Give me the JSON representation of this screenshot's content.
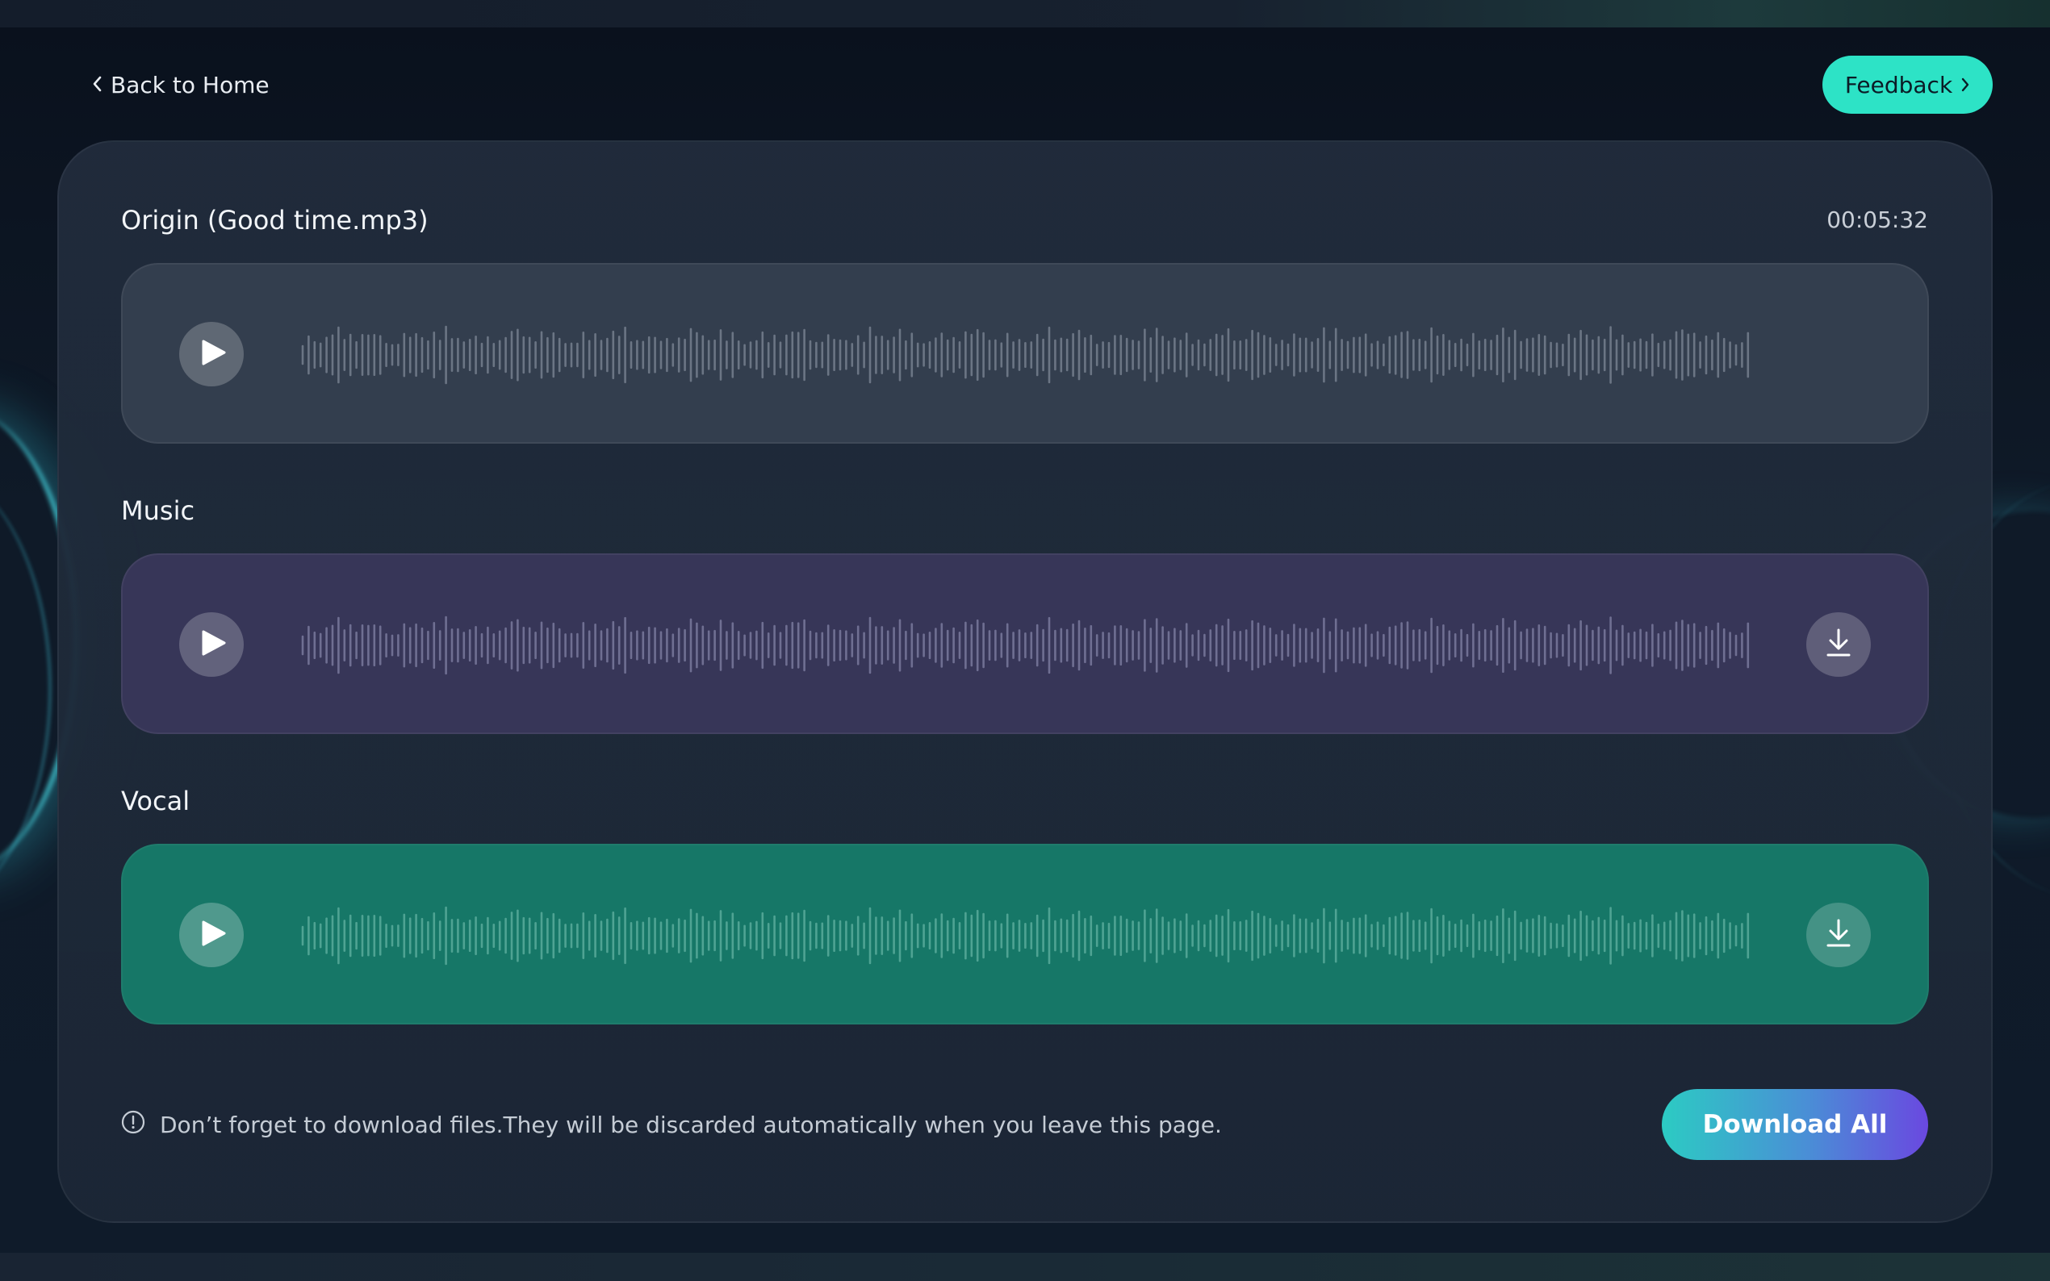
{
  "nav": {
    "back_label": "Back to Home",
    "back_icon": "chevron-left-icon",
    "feedback_label": "Feedback",
    "feedback_icon": "chevron-right-icon"
  },
  "tracks": [
    {
      "id": "origin",
      "title": "Origin (Good time.mp3)",
      "duration": "00:05:32",
      "downloadable": false,
      "color": "#333e4e",
      "wave_color": "#6b7584"
    },
    {
      "id": "music",
      "title": "Music",
      "downloadable": true,
      "color": "#373658",
      "wave_color": "#6f6f92"
    },
    {
      "id": "vocal",
      "title": "Vocal",
      "downloadable": true,
      "color": "#167767",
      "wave_color": "#4fa393"
    }
  ],
  "footer": {
    "notice": "Don’t forget to download files.They will be discarded automatically when you leave this page.",
    "notice_icon": "info-circle-icon",
    "download_all_label": "Download All"
  },
  "colors": {
    "accent": "#2de3c6",
    "gradient_start": "#2ccbc3",
    "gradient_end": "#6a48e0",
    "panel": "#212c3c"
  }
}
